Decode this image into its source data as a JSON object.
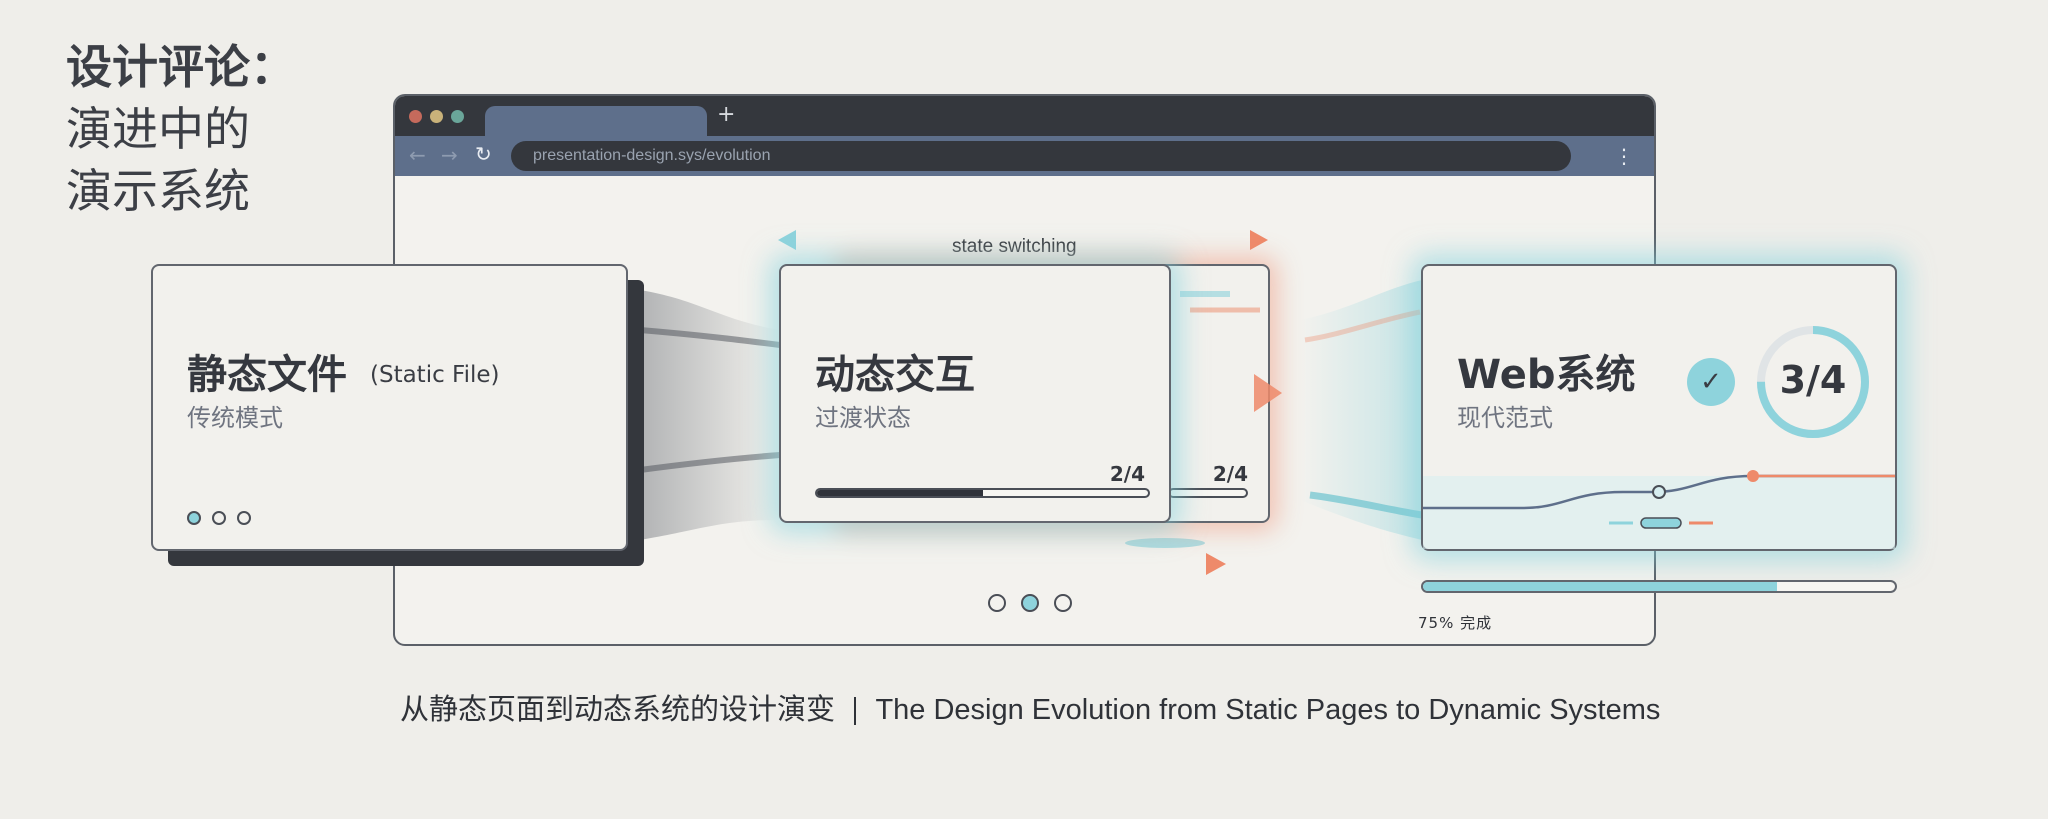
{
  "title": {
    "line1": "设计评论：",
    "line2": "演进中的",
    "line3": "演示系统"
  },
  "browser": {
    "new_tab_icon": "plus-icon",
    "url": "presentation-design.sys/evolution",
    "back_icon": "arrow-left-icon",
    "forward_icon": "arrow-right-icon",
    "reload_icon": "reload-icon",
    "menu_icon": "kebab-menu-icon"
  },
  "state_switching_label": "state switching",
  "static_card": {
    "title": "静态文件",
    "title_en": "(Static File)",
    "subtitle": "传统模式"
  },
  "dynamic_card": {
    "title": "动态交互",
    "subtitle": "过渡状态",
    "counter": "2/4",
    "back_counter": "2/4",
    "progress": 0.5
  },
  "web_card": {
    "title": "Web系统",
    "subtitle": "现代范式",
    "check_icon": "check-icon",
    "ring_label": "3/4",
    "ring_progress": 0.75
  },
  "web_progress": {
    "value": 0.75,
    "label": "75% 完成"
  },
  "pager_active_index": 1,
  "caption": {
    "zh": "从静态页面到动态系统的设计演变",
    "en": "The Design Evolution from Static Pages to Dynamic Systems"
  },
  "colors": {
    "accent_teal": "#8ed3dc",
    "accent_orange": "#ee8a6a",
    "dark": "#34373d",
    "chrome_blue": "#5e6f8b"
  }
}
